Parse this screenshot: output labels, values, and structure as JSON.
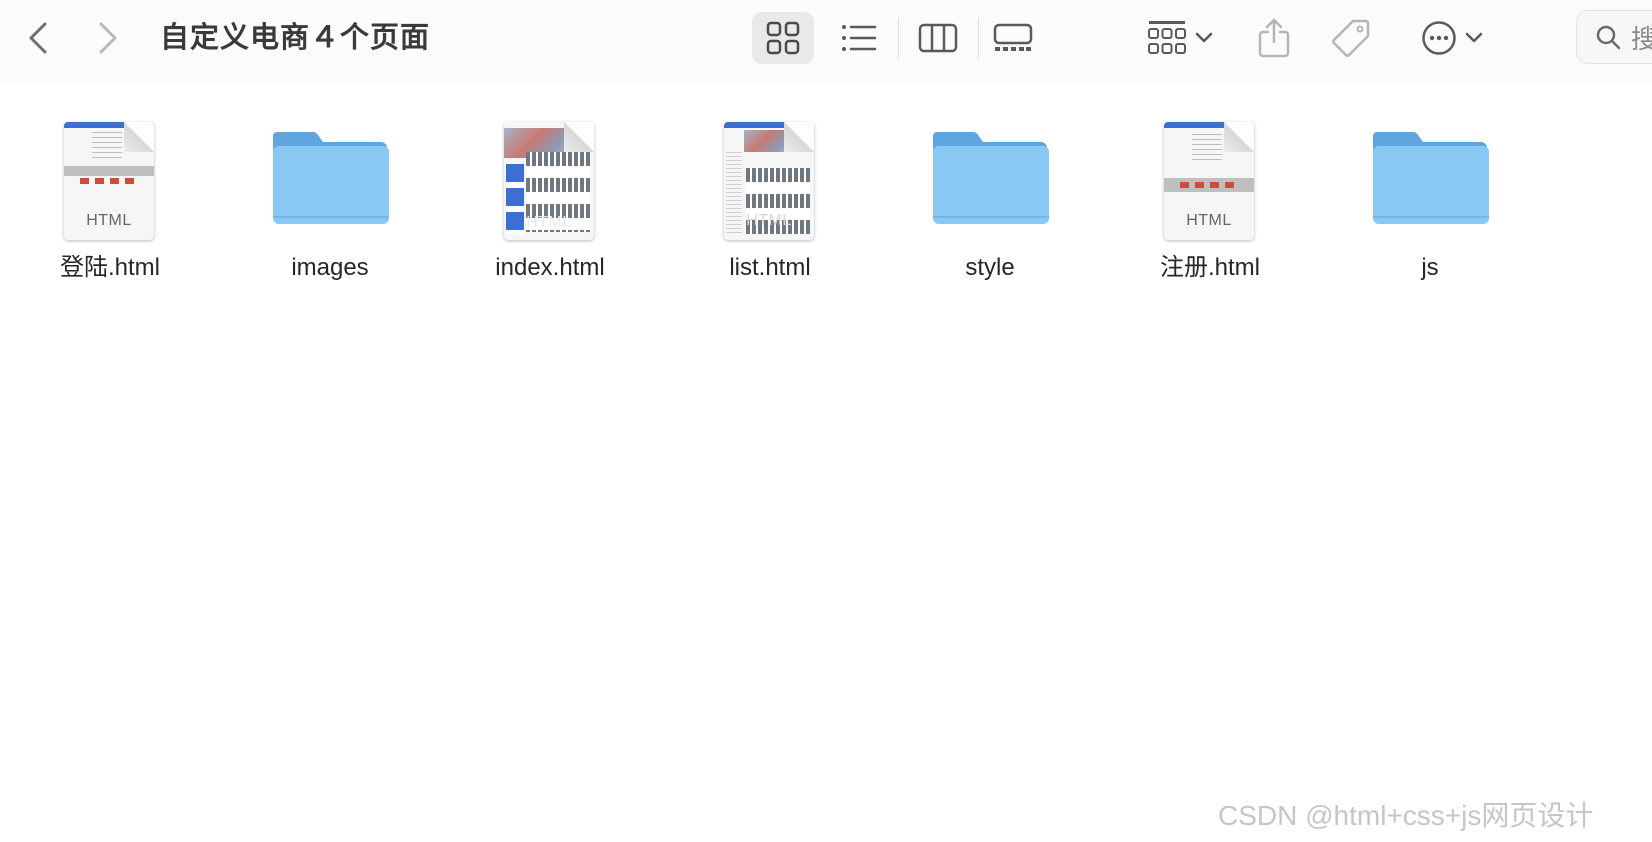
{
  "window": {
    "title": "自定义电商４个页面"
  },
  "toolbar": {
    "icons": {
      "back": "chevron-left-icon",
      "forward": "chevron-right-icon",
      "icon_view": "grid-view-icon",
      "list_view": "list-view-icon",
      "column_view": "column-view-icon",
      "gallery_view": "gallery-view-icon",
      "group": "group-icon",
      "share": "share-icon",
      "tag": "tag-icon",
      "more": "more-actions-icon",
      "search": "search-icon"
    },
    "search_placeholder": "搜"
  },
  "files": [
    {
      "name": "登陆.html",
      "type": "html",
      "thumb": "form"
    },
    {
      "name": "images",
      "type": "folder"
    },
    {
      "name": "index.html",
      "type": "html",
      "thumb": "index"
    },
    {
      "name": "list.html",
      "type": "html",
      "thumb": "list"
    },
    {
      "name": "style",
      "type": "folder"
    },
    {
      "name": "注册.html",
      "type": "html",
      "thumb": "form"
    },
    {
      "name": "js",
      "type": "folder"
    }
  ],
  "doc_label": "HTML",
  "watermark": "CSDN @html+css+js网页设计",
  "colors": {
    "folder": "#8ac8f4",
    "folder_tab": "#5fa6e0",
    "toolbar_bg": "#fbfbfb",
    "active_view_bg": "#e9e9e9"
  }
}
